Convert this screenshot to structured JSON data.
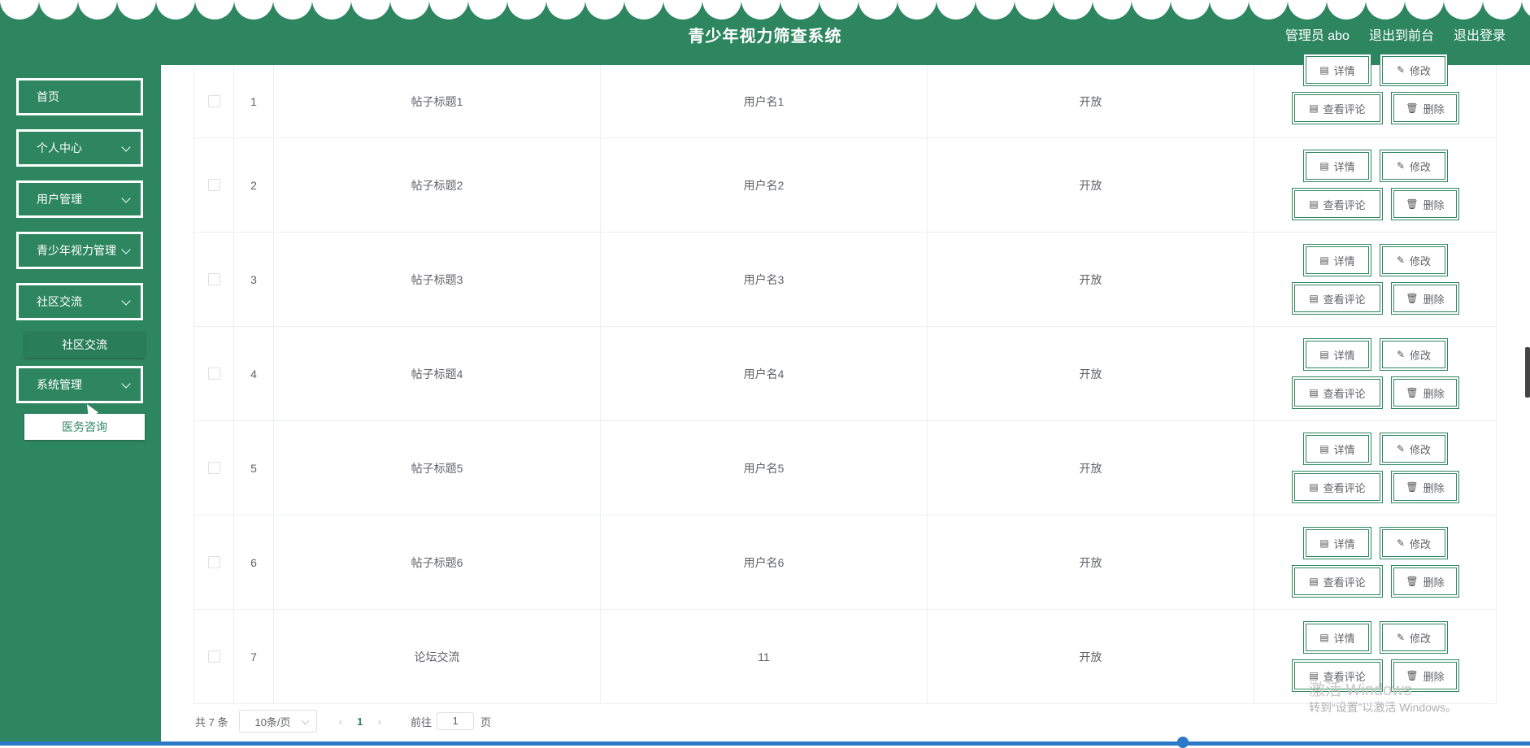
{
  "header": {
    "title": "青少年视力筛查系统",
    "user_label": "管理员 abo",
    "to_front": "退出到前台",
    "logout": "退出登录"
  },
  "sidebar": {
    "items": [
      {
        "label": "首页"
      },
      {
        "label": "个人中心"
      },
      {
        "label": "用户管理"
      },
      {
        "label": "青少年视力管理"
      },
      {
        "label": "社区交流"
      },
      {
        "label": "系统管理"
      }
    ],
    "sub_community": "社区交流",
    "sub_system": "医务咨询"
  },
  "actions": {
    "detail": "详情",
    "edit": "修改",
    "comments": "查看评论",
    "delete": "删除"
  },
  "rows": [
    {
      "index": "1",
      "title": "帖子标题1",
      "user": "用户名1",
      "status": "开放"
    },
    {
      "index": "2",
      "title": "帖子标题2",
      "user": "用户名2",
      "status": "开放"
    },
    {
      "index": "3",
      "title": "帖子标题3",
      "user": "用户名3",
      "status": "开放"
    },
    {
      "index": "4",
      "title": "帖子标题4",
      "user": "用户名4",
      "status": "开放"
    },
    {
      "index": "5",
      "title": "帖子标题5",
      "user": "用户名5",
      "status": "开放"
    },
    {
      "index": "6",
      "title": "帖子标题6",
      "user": "用户名6",
      "status": "开放"
    },
    {
      "index": "7",
      "title": "论坛交流",
      "user": "11",
      "status": "开放"
    }
  ],
  "pagination": {
    "total": "共 7 条",
    "page_size": "10条/页",
    "current": "1",
    "goto_label": "前往",
    "goto_value": "1",
    "page_suffix": "页"
  },
  "watermark": {
    "line1": "激活 Windows",
    "line2": "转到“设置”以激活 Windows。"
  },
  "colors": {
    "primary": "#2e8660",
    "accent_bar": "#2c79c9"
  }
}
